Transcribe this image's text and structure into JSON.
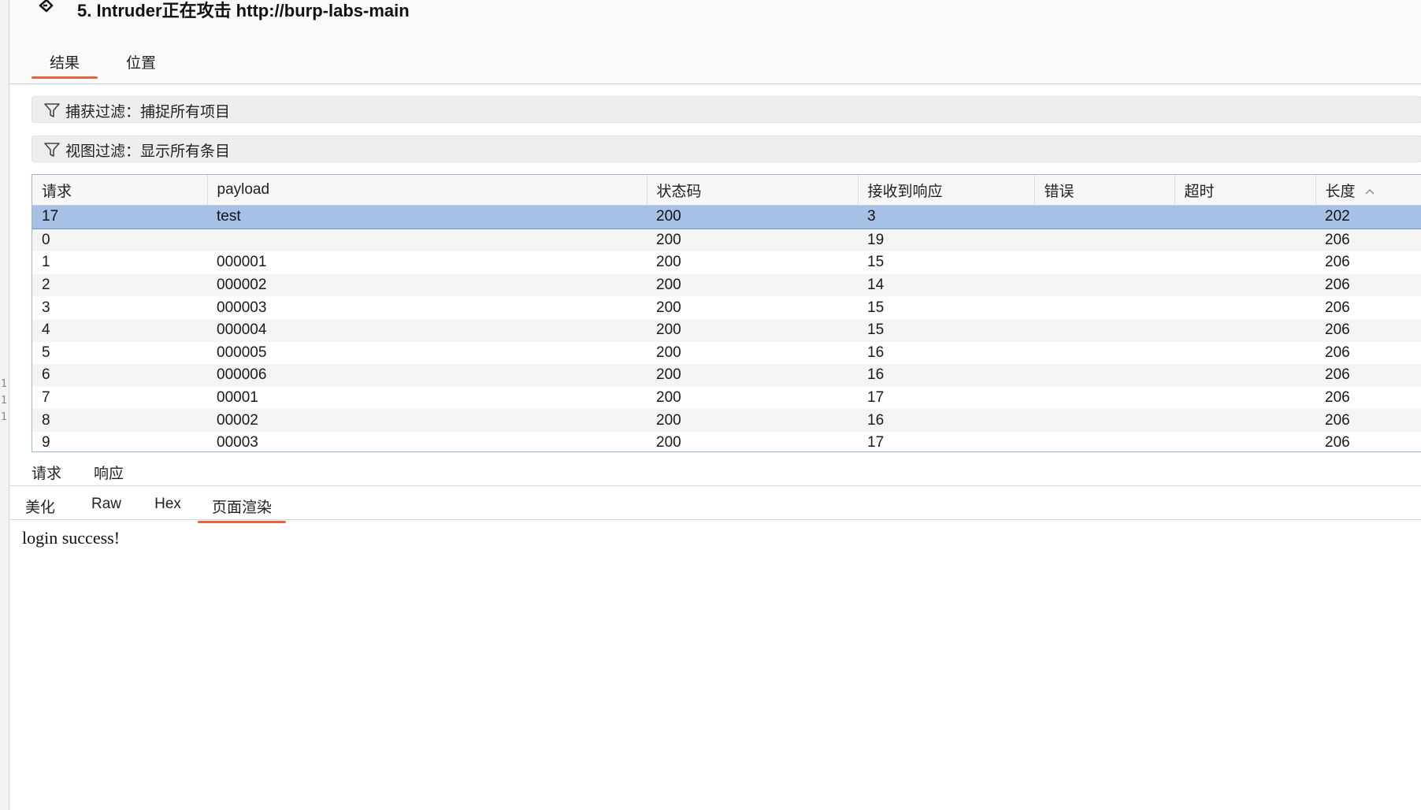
{
  "window": {
    "title": "5. Intruder正在攻击 http://burp-labs-main"
  },
  "top_tabs": [
    {
      "label": "结果",
      "active": true
    },
    {
      "label": "位置",
      "active": false
    }
  ],
  "filters": {
    "capture_filter": "捕获过滤：捕捉所有项目",
    "view_filter": "视图过滤：显示所有条目"
  },
  "table": {
    "columns": [
      "请求",
      "payload",
      "状态码",
      "接收到响应",
      "错误",
      "超时",
      "长度"
    ],
    "sorted_column": "长度",
    "rows": [
      {
        "request": "17",
        "payload": "test",
        "status": "200",
        "received": "3",
        "error": "",
        "timeout": "",
        "length": "202",
        "selected": true
      },
      {
        "request": "0",
        "payload": "",
        "status": "200",
        "received": "19",
        "error": "",
        "timeout": "",
        "length": "206"
      },
      {
        "request": "1",
        "payload": "000001",
        "status": "200",
        "received": "15",
        "error": "",
        "timeout": "",
        "length": "206"
      },
      {
        "request": "2",
        "payload": "000002",
        "status": "200",
        "received": "14",
        "error": "",
        "timeout": "",
        "length": "206"
      },
      {
        "request": "3",
        "payload": "000003",
        "status": "200",
        "received": "15",
        "error": "",
        "timeout": "",
        "length": "206"
      },
      {
        "request": "4",
        "payload": "000004",
        "status": "200",
        "received": "15",
        "error": "",
        "timeout": "",
        "length": "206"
      },
      {
        "request": "5",
        "payload": "000005",
        "status": "200",
        "received": "16",
        "error": "",
        "timeout": "",
        "length": "206"
      },
      {
        "request": "6",
        "payload": "000006",
        "status": "200",
        "received": "16",
        "error": "",
        "timeout": "",
        "length": "206"
      },
      {
        "request": "7",
        "payload": "00001",
        "status": "200",
        "received": "17",
        "error": "",
        "timeout": "",
        "length": "206"
      },
      {
        "request": "8",
        "payload": "00002",
        "status": "200",
        "received": "16",
        "error": "",
        "timeout": "",
        "length": "206"
      },
      {
        "request": "9",
        "payload": "00003",
        "status": "200",
        "received": "17",
        "error": "",
        "timeout": "",
        "length": "206"
      }
    ]
  },
  "message_tabs": [
    {
      "label": "请求",
      "active": false
    },
    {
      "label": "响应",
      "active": true
    }
  ],
  "view_tabs": [
    {
      "label": "美化",
      "active": false
    },
    {
      "label": "Raw",
      "active": false
    },
    {
      "label": "Hex",
      "active": false
    },
    {
      "label": "页面渲染",
      "active": true
    }
  ],
  "response": {
    "rendered_text": "login success!"
  },
  "side_gutter": [
    "1",
    "1",
    "1"
  ],
  "colors": {
    "accent": "#e8643a",
    "selection": "#a6c0e6",
    "table_border": "#9cb6d8"
  },
  "icons": {
    "app": "burp-intruder-icon",
    "filter": "funnel-icon",
    "sort": "chevron-up-icon"
  }
}
